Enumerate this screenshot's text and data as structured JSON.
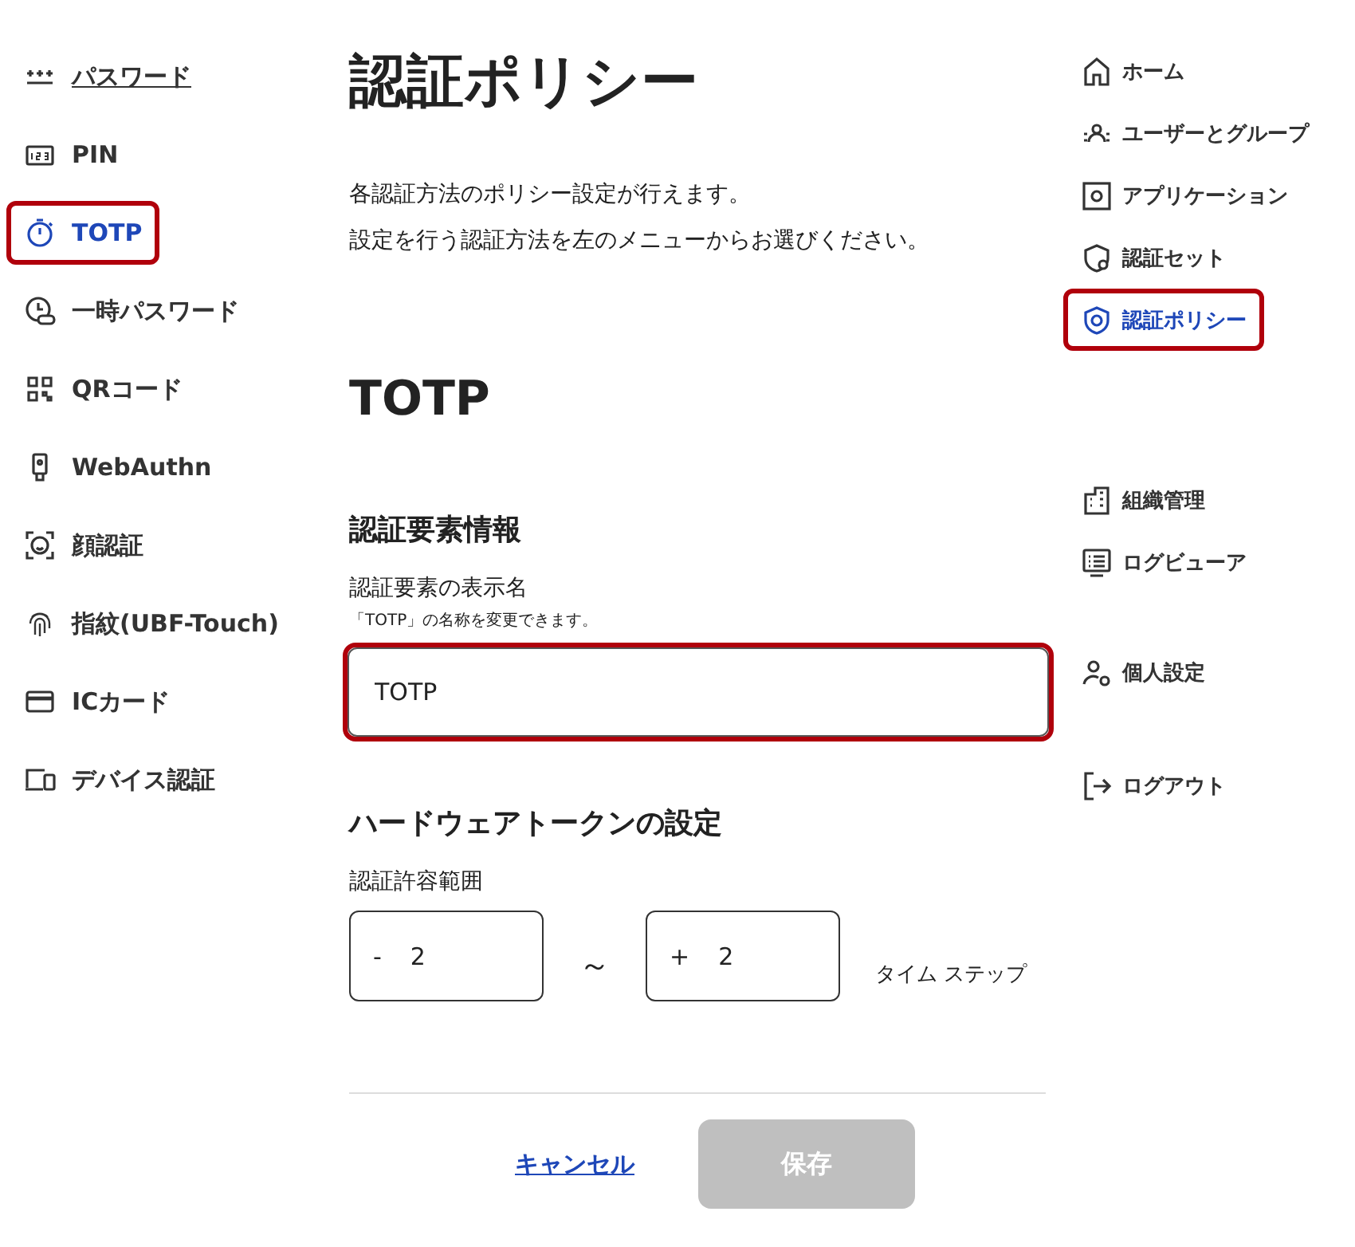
{
  "left_nav": [
    {
      "label": "パスワード",
      "selected": false,
      "hovered": true,
      "highlighted": false
    },
    {
      "label": "PIN",
      "selected": false,
      "hovered": false,
      "highlighted": false
    },
    {
      "label": "TOTP",
      "selected": true,
      "hovered": false,
      "highlighted": true
    },
    {
      "label": "一時パスワード",
      "selected": false,
      "hovered": false,
      "highlighted": false
    },
    {
      "label": "QRコード",
      "selected": false,
      "hovered": false,
      "highlighted": false
    },
    {
      "label": "WebAuthn",
      "selected": false,
      "hovered": false,
      "highlighted": false
    },
    {
      "label": "顔認証",
      "selected": false,
      "hovered": false,
      "highlighted": false
    },
    {
      "label": "指紋(UBF-Touch)",
      "selected": false,
      "hovered": false,
      "highlighted": false
    },
    {
      "label": "ICカード",
      "selected": false,
      "hovered": false,
      "highlighted": false
    },
    {
      "label": "デバイス認証",
      "selected": false,
      "hovered": false,
      "highlighted": false
    }
  ],
  "title": "認証ポリシー",
  "description": [
    "各認証方法のポリシー設定が行えます。",
    "設定を行う認証方法を左のメニューからお選びください。"
  ],
  "method_title": "TOTP",
  "factor_section": {
    "heading": "認証要素情報",
    "label": "認証要素の表示名",
    "hint": "「TOTP」の名称を変更できます。",
    "value": "TOTP",
    "highlighted": true
  },
  "token_section": {
    "heading": "ハードウェアトークンの設定",
    "label": "認証許容範囲",
    "from": {
      "sign": "-",
      "value": "2"
    },
    "separator": "～",
    "to": {
      "sign": "+",
      "value": "2"
    },
    "unit": "タイム ステップ"
  },
  "actions": {
    "cancel": "キャンセル",
    "save": "保存",
    "save_disabled": true
  },
  "right_nav": [
    [
      {
        "label": "ホーム",
        "selected": false,
        "highlighted": false
      },
      {
        "label": "ユーザーとグループ",
        "selected": false,
        "highlighted": false
      },
      {
        "label": "アプリケーション",
        "selected": false,
        "highlighted": false
      },
      {
        "label": "認証セット",
        "selected": false,
        "highlighted": false
      },
      {
        "label": "認証ポリシー",
        "selected": true,
        "highlighted": true
      }
    ],
    [
      {
        "label": "組織管理",
        "selected": false,
        "highlighted": false
      },
      {
        "label": "ログビューア",
        "selected": false,
        "highlighted": false
      }
    ],
    [
      {
        "label": "個人設定",
        "selected": false,
        "highlighted": false
      }
    ],
    [
      {
        "label": "ログアウト",
        "selected": false,
        "highlighted": false
      }
    ]
  ]
}
